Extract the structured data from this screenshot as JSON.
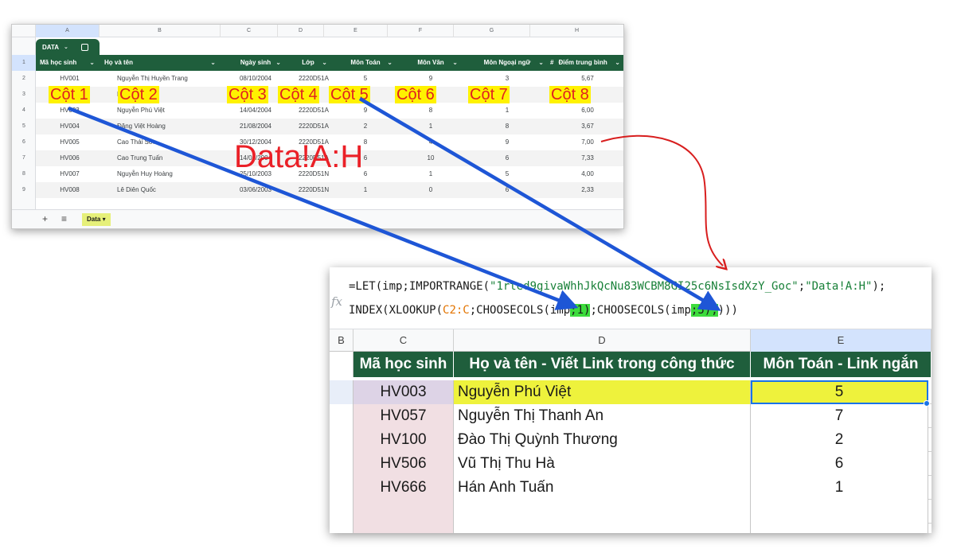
{
  "source_sheet": {
    "col_letters": [
      "A",
      "B",
      "C",
      "D",
      "E",
      "F",
      "G",
      "H"
    ],
    "row_numbers": [
      "1",
      "2",
      "3",
      "4",
      "5",
      "6",
      "7",
      "8",
      "9"
    ],
    "table_tag": "DATA",
    "headers": [
      "Mã học sinh",
      "Họ và tên",
      "Ngày sinh",
      "Lớp",
      "Môn Toán",
      "Môn Văn",
      "Môn Ngoại ngữ",
      "Điểm trung bình"
    ],
    "hash_symbol": "#",
    "rows": [
      [
        "HV001",
        "Nguyễn Thị Huyền Trang",
        "08/10/2004",
        "2220D51A",
        "5",
        "9",
        "3",
        "5,67"
      ],
      [
        "HV002",
        "Nguyễn",
        "",
        "",
        "",
        "",
        "",
        ""
      ],
      [
        "HV003",
        "Nguyễn Phú Việt",
        "14/04/2004",
        "2220D51A",
        "9",
        "8",
        "1",
        "6,00"
      ],
      [
        "HV004",
        "Đặng Việt Hoàng",
        "21/08/2004",
        "2220D51A",
        "2",
        "1",
        "8",
        "3,67"
      ],
      [
        "HV005",
        "Cao Thái Sơn",
        "30/12/2004",
        "2220D51A",
        "8",
        "4",
        "9",
        "7,00"
      ],
      [
        "HV006",
        "Cao Trung Tuấn",
        "14/01/2004",
        "2220D51A",
        "6",
        "10",
        "6",
        "7,33"
      ],
      [
        "HV007",
        "Nguyễn Huy Hoàng",
        "25/10/2003",
        "2220D51N",
        "6",
        "1",
        "5",
        "4,00"
      ],
      [
        "HV008",
        "Lê Diên Quốc",
        "03/06/2003",
        "2220D51N",
        "1",
        "0",
        "6",
        "2,33"
      ]
    ],
    "sheet_tab": "Data",
    "add_sheet": "+",
    "sheet_menu": "≡"
  },
  "column_labels": [
    "Cột 1",
    "Cột 2",
    "Cột 3",
    "Cột 4",
    "Cột 5",
    "Cột 6",
    "Cột 7",
    "Cột 8"
  ],
  "range_label": "Data!A:H",
  "result_sheet": {
    "fx_symbol": "fx",
    "formula_line1_a": "=LET(imp;IMPORTRANGE(",
    "formula_line1_b": "\"1rted9givaWhhJkQcNu83WCBM8GI25c6NsIsdXzY_Goc\"",
    "formula_line1_c": ";",
    "formula_line1_d": "\"Data!A:H\"",
    "formula_line1_e": ");",
    "formula_line2_a": "INDEX(XLOOKUP(",
    "formula_line2_b": "C2:C",
    "formula_line2_c": ";CHOOSECOLS(imp",
    "formula_line2_d": ";1)",
    "formula_line2_e": ";CHOOSECOLS(imp",
    "formula_line2_f": ";5);",
    "formula_line2_g": ")))",
    "col_letters": [
      "B",
      "C",
      "D",
      "E"
    ],
    "headers": [
      "Mã học sinh",
      "Họ và tên - Viết Link trong công thức",
      "Môn Toán - Link ngắn"
    ],
    "rows": [
      [
        "HV003",
        "Nguyễn Phú Việt",
        "5"
      ],
      [
        "HV057",
        "Nguyễn Thị Thanh An",
        "7"
      ],
      [
        "HV100",
        "Đào Thị Quỳnh Thương",
        "2"
      ],
      [
        "HV506",
        "Vũ Thị Thu Hà",
        "6"
      ],
      [
        "HV666",
        "Hán Anh Tuấn",
        "1"
      ],
      [
        "",
        "",
        ""
      ],
      [
        "",
        "",
        ""
      ]
    ]
  },
  "colors": {
    "header_green": "#1f5e3c",
    "label_yellow": "#fff200",
    "label_red": "#e02020",
    "arrow_blue": "#1e56d6",
    "arrow_red": "#d81e1e",
    "formula_highlight": "#3ddc3d",
    "row_highlight": "#eef23c"
  }
}
